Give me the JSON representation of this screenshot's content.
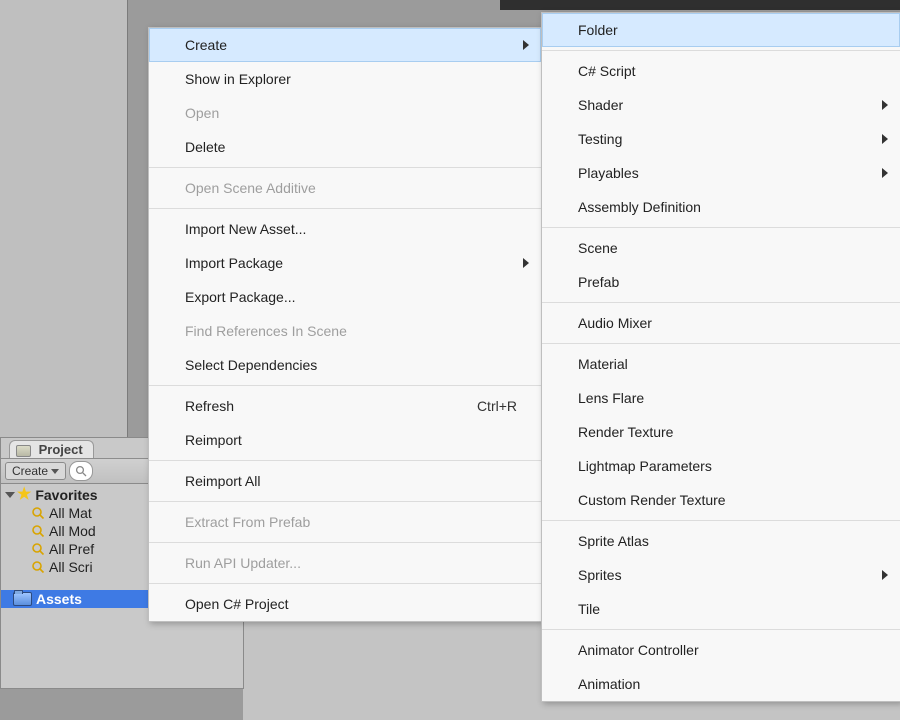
{
  "viewport": {
    "top_dark_strip": true
  },
  "project": {
    "tab_label": "Project",
    "create_btn": "Create",
    "favorites": {
      "label": "Favorites",
      "items": [
        "All Mat",
        "All Mod",
        "All Pref",
        "All Scri"
      ]
    },
    "root_folder": "Assets"
  },
  "context_menu": {
    "groups": [
      [
        {
          "label": "Create",
          "has_submenu": true,
          "highlighted": true
        },
        {
          "label": "Show in Explorer"
        },
        {
          "label": "Open",
          "disabled": true
        },
        {
          "label": "Delete"
        }
      ],
      [
        {
          "label": "Open Scene Additive",
          "disabled": true
        }
      ],
      [
        {
          "label": "Import New Asset..."
        },
        {
          "label": "Import Package",
          "has_submenu": true
        },
        {
          "label": "Export Package..."
        },
        {
          "label": "Find References In Scene",
          "disabled": true
        },
        {
          "label": "Select Dependencies"
        }
      ],
      [
        {
          "label": "Refresh",
          "hotkey": "Ctrl+R"
        },
        {
          "label": "Reimport"
        }
      ],
      [
        {
          "label": "Reimport All"
        }
      ],
      [
        {
          "label": "Extract From Prefab",
          "disabled": true
        }
      ],
      [
        {
          "label": "Run API Updater...",
          "disabled": true
        }
      ],
      [
        {
          "label": "Open C# Project"
        }
      ]
    ]
  },
  "create_submenu": {
    "groups": [
      [
        {
          "label": "Folder",
          "highlighted": true
        }
      ],
      [
        {
          "label": "C# Script"
        },
        {
          "label": "Shader",
          "has_submenu": true
        },
        {
          "label": "Testing",
          "has_submenu": true
        },
        {
          "label": "Playables",
          "has_submenu": true
        },
        {
          "label": "Assembly Definition"
        }
      ],
      [
        {
          "label": "Scene"
        },
        {
          "label": "Prefab"
        }
      ],
      [
        {
          "label": "Audio Mixer"
        }
      ],
      [
        {
          "label": "Material"
        },
        {
          "label": "Lens Flare"
        },
        {
          "label": "Render Texture"
        },
        {
          "label": "Lightmap Parameters"
        },
        {
          "label": "Custom Render Texture"
        }
      ],
      [
        {
          "label": "Sprite Atlas"
        },
        {
          "label": "Sprites",
          "has_submenu": true
        },
        {
          "label": "Tile"
        }
      ],
      [
        {
          "label": "Animator Controller"
        },
        {
          "label": "Animation"
        }
      ]
    ]
  }
}
